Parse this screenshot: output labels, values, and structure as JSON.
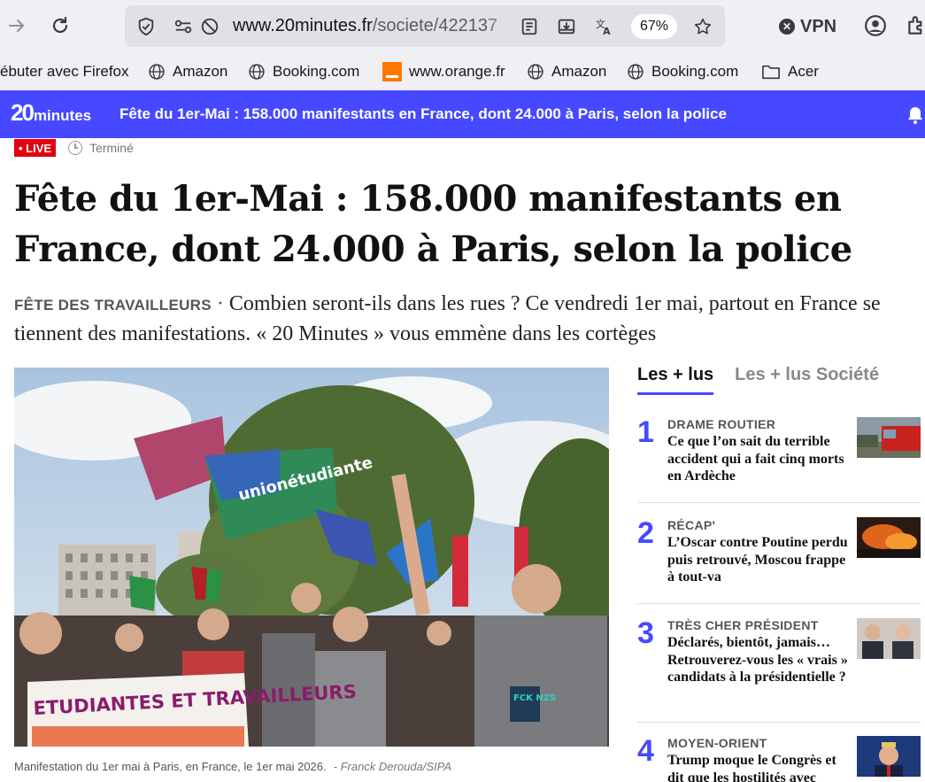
{
  "browser": {
    "url_host": "www.20minutes.fr",
    "url_path": "/societe/422137",
    "zoom": "67%",
    "vpn_label": "VPN"
  },
  "bookmarks": [
    {
      "label": "ébuter avec Firefox",
      "icon": "firefox-icon"
    },
    {
      "label": "Amazon",
      "icon": "globe-icon"
    },
    {
      "label": "Booking.com",
      "icon": "globe-icon"
    },
    {
      "label": "www.orange.fr",
      "icon": "orange-icon"
    },
    {
      "label": "Amazon",
      "icon": "globe-icon"
    },
    {
      "label": "Booking.com",
      "icon": "globe-icon"
    },
    {
      "label": "Acer",
      "icon": "folder-icon"
    }
  ],
  "header": {
    "logo_num": "20",
    "logo_word": "minutes",
    "title": "Fête du 1er-Mai : 158.000 manifestants en France, dont 24.000 à Paris, selon la police",
    "brand_color": "#4649ff"
  },
  "article": {
    "live_badge": "• LIVE",
    "status": "Terminé",
    "headline": "Fête du 1er-Mai : 158.000 manifestants en France, dont 24.000 à Paris, selon la police",
    "kicker": "FÊTE DES TRAVAILLEURS",
    "separator": " · ",
    "lede": "Combien seront-ils dans les rues ? Ce vendredi 1er mai, partout en France se tiennent des manifestations. « 20 Minutes » vous emmène dans les cortèges",
    "photo_caption": "Manifestation du 1er mai à Paris, en France, le 1er mai 2026.",
    "photo_credit": "- Franck Derouda/SIPA",
    "banner_text": "ETUDIANTES ET TRAVAILLEURS",
    "flag_text": "unionétudiante",
    "shirt_text": "FCK NZS"
  },
  "sidebar": {
    "tabs": [
      {
        "label": "Les + lus",
        "active": true
      },
      {
        "label": "Les + lus Société",
        "active": false
      }
    ],
    "items": [
      {
        "rank": "1",
        "kicker": "DRAME ROUTIER",
        "title": "Ce que l’on sait du terrible accident qui a fait cinq morts en Ardèche"
      },
      {
        "rank": "2",
        "kicker": "RÉCAP'",
        "title": "L’Oscar contre Poutine perdu puis retrouvé, Moscou frappe à tout-va"
      },
      {
        "rank": "3",
        "kicker": "TRÈS CHER PRÉSIDENT",
        "title": "Déclarés, bientôt, jamais… Retrouverez-vous les « vrais » candidats à la présidentielle ?"
      },
      {
        "rank": "4",
        "kicker": "MOYEN-ORIENT",
        "title": "Trump moque le Congrès et dit que les hostilités avec"
      }
    ]
  },
  "colors": {
    "accent": "#4649ff",
    "live_red": "#e1000f"
  }
}
